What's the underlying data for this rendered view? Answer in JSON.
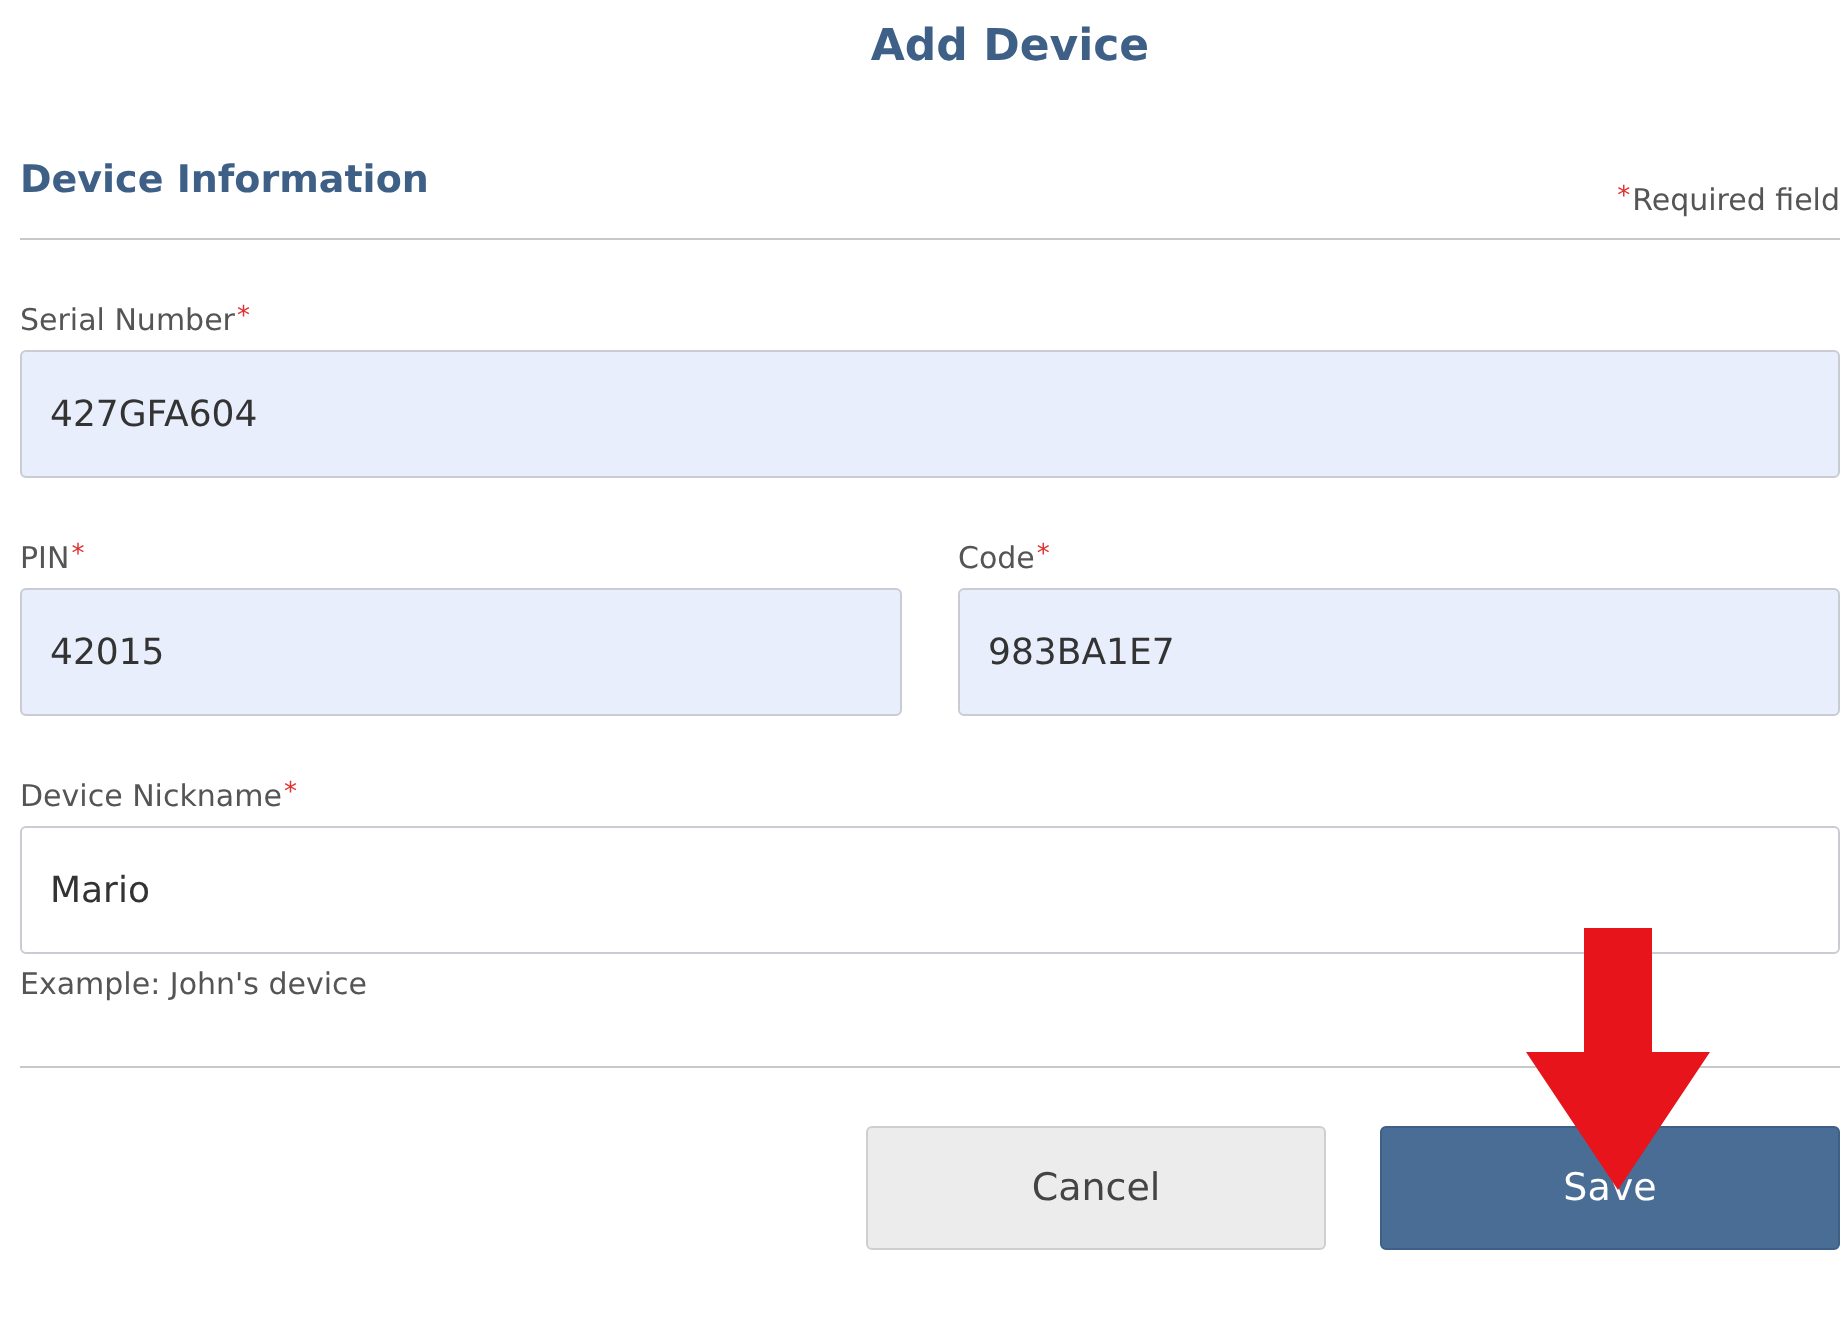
{
  "title": "Add Device",
  "section": {
    "title": "Device Information",
    "required_note": "Required field"
  },
  "required_mark": "*",
  "rows": [
    [
      {
        "label": "Serial Number",
        "value": "427GFA604",
        "required": true,
        "autofilled": true
      }
    ],
    [
      {
        "label": "PIN",
        "value": "42015",
        "required": true,
        "autofilled": true
      },
      {
        "label": "Code",
        "value": "983BA1E7",
        "required": true,
        "autofilled": true
      }
    ],
    [
      {
        "label": "Device Nickname",
        "value": "Mario",
        "required": true,
        "autofilled": false,
        "hint": "Example: John's device"
      }
    ]
  ],
  "buttons": [
    {
      "label": "Cancel",
      "kind": "secondary"
    },
    {
      "label": "Save",
      "kind": "primary"
    }
  ],
  "annotation": {
    "kind": "arrow"
  }
}
